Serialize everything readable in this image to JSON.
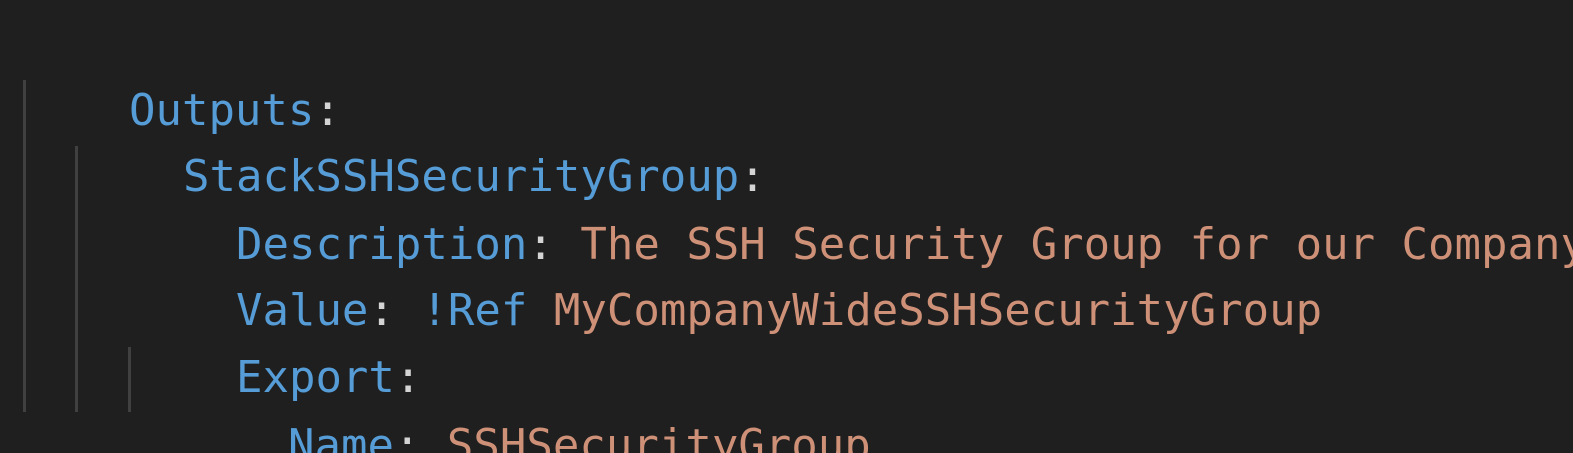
{
  "editor": {
    "background": "#1f1f1f",
    "colors": {
      "key": "#569cd6",
      "string": "#ce9178",
      "punctuation": "#d4d4d4",
      "indent_guide": "#404040"
    },
    "lines": [
      {
        "key": "Outputs",
        "sep": ":"
      },
      {
        "key": "StackSSHSecurityGroup",
        "sep": ":"
      },
      {
        "key": "Description",
        "sep": ": ",
        "value": "The SSH Security Group for our Company"
      },
      {
        "key": "Value",
        "sep": ": ",
        "tag": "!Ref",
        "value": "MyCompanyWideSSHSecurityGroup"
      },
      {
        "key": "Export",
        "sep": ":"
      },
      {
        "key": "Name",
        "sep": ": ",
        "value": "SSHSecurityGroup"
      }
    ]
  }
}
